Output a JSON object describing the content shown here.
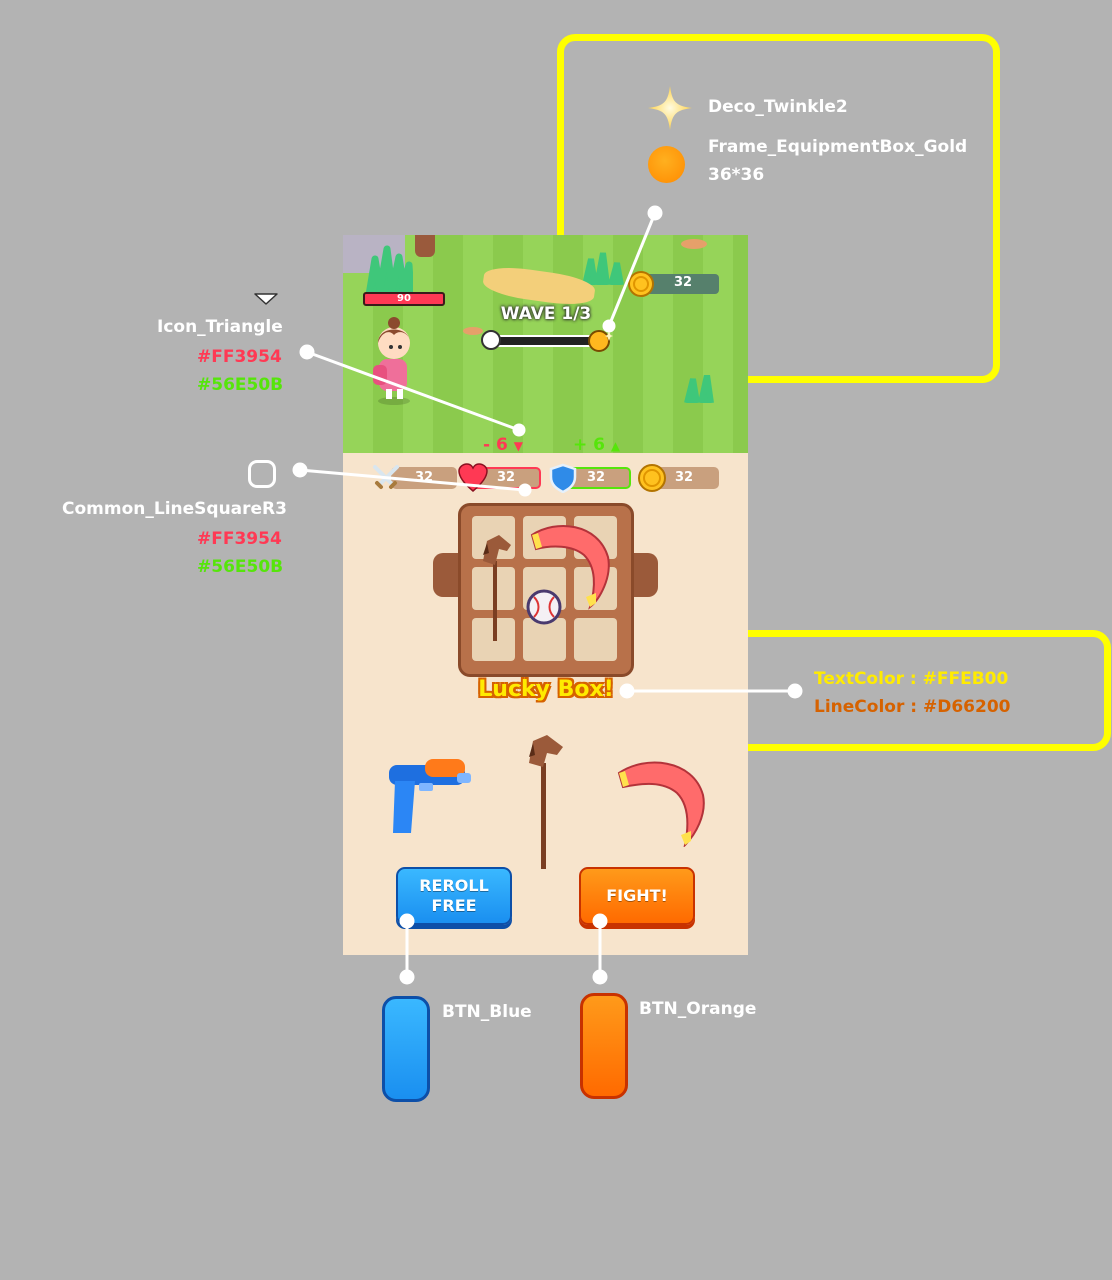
{
  "annotations": {
    "deco_twinkle": "Deco_Twinkle2",
    "frame_gold": "Frame_EquipmentBox_Gold",
    "frame_gold_size": "36*36",
    "icon_triangle": "Icon_Triangle",
    "icon_triangle_color_red": "#FF3954",
    "icon_triangle_color_green": "#56E50B",
    "line_square": "Common_LineSquareR3",
    "line_square_color_red": "#FF3954",
    "line_square_color_green": "#56E50B",
    "text_color": "TextColor : #FFEB00",
    "line_color": "LineColor : #D66200",
    "btn_blue": "BTN_Blue",
    "btn_orange": "BTN_Orange"
  },
  "game": {
    "player_hp": "90",
    "wave_label": "WAVE 1/3",
    "wave_progress": 0.0,
    "top_coins": "32",
    "delta_down": "- 6",
    "delta_up": "+ 6",
    "stats": {
      "attack": "32",
      "health": "32",
      "shield": "32",
      "gold": "32"
    },
    "lucky_box_label": "Lucky Box!",
    "reroll_line1": "REROLL",
    "reroll_line2": "FREE",
    "fight_label": "FIGHT!"
  },
  "colors": {
    "red": "#FF3954",
    "green": "#56E50B",
    "text_yellow": "#FFEB00",
    "line_orange": "#D66200",
    "highlight": "#FFFF00"
  },
  "icons": [
    "twinkle-icon",
    "gold-coin-icon",
    "triangle-icon",
    "line-square-icon",
    "sword-icon",
    "heart-icon",
    "shield-icon",
    "water-gun-icon",
    "boomerang-icon",
    "hobby-horse-icon",
    "baseball-icon"
  ]
}
